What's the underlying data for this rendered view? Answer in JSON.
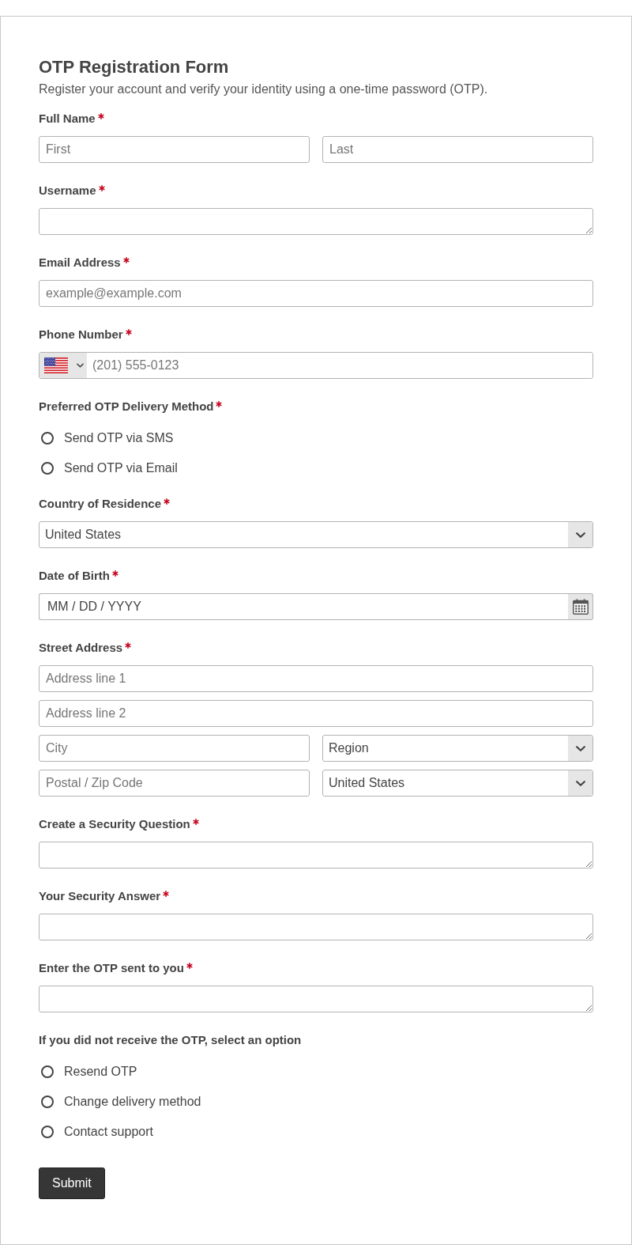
{
  "form": {
    "title": "OTP Registration Form",
    "description": "Register your account and verify your identity using a one-time password (OTP)."
  },
  "fields": [
    {
      "kind": "name",
      "label": "Full Name",
      "required": true,
      "inputs": [
        {
          "placeholder": "First"
        },
        {
          "placeholder": "Last"
        }
      ]
    },
    {
      "kind": "textarea",
      "label": "Username",
      "required": true
    },
    {
      "kind": "text",
      "label": "Email Address",
      "required": true,
      "placeholder": "example@example.com"
    },
    {
      "kind": "phone",
      "label": "Phone Number",
      "required": true,
      "placeholder": "(201) 555-0123"
    },
    {
      "kind": "radio",
      "label": "Preferred OTP Delivery Method",
      "required": true,
      "options": [
        {
          "label": "Send OTP via SMS",
          "selected": false
        },
        {
          "label": "Send OTP via Email",
          "selected": false
        }
      ]
    },
    {
      "kind": "select",
      "label": "Country of Residence",
      "required": true,
      "value": "United States"
    },
    {
      "kind": "date",
      "label": "Date of Birth",
      "required": true,
      "placeholder": "MM / DD / YYYY"
    },
    {
      "kind": "address",
      "label": "Street Address",
      "required": true,
      "rows": [
        {
          "inputs": [
            {
              "kind": "text",
              "placeholder": "Address line 1"
            }
          ]
        },
        {
          "inputs": [
            {
              "kind": "text",
              "placeholder": "Address line 2"
            }
          ]
        },
        {
          "inputs": [
            {
              "kind": "text",
              "placeholder": "City"
            },
            {
              "kind": "select",
              "value": "Region"
            }
          ]
        },
        {
          "inputs": [
            {
              "kind": "text",
              "placeholder": "Postal / Zip Code"
            },
            {
              "kind": "select",
              "value": "United States"
            }
          ]
        }
      ]
    },
    {
      "kind": "textarea",
      "label": "Create a Security Question",
      "required": true
    },
    {
      "kind": "textarea",
      "label": "Your Security Answer",
      "required": true
    },
    {
      "kind": "textarea",
      "label": "Enter the OTP sent to you",
      "required": true
    },
    {
      "kind": "radio",
      "label": "If you did not receive the OTP, select an option",
      "required": false,
      "options": [
        {
          "label": "Resend OTP",
          "selected": false
        },
        {
          "label": "Change delivery method",
          "selected": false
        },
        {
          "label": "Contact support",
          "selected": false
        }
      ]
    }
  ],
  "submit_button": {
    "label": "Submit"
  }
}
